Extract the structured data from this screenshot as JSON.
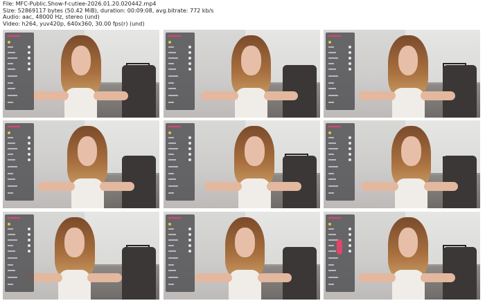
{
  "header": {
    "file": "File: MFC-Public.Show-f-cutiee-2026.01.20.020442.mp4",
    "size": "Size: 52869117 bytes (50.42 MiB), duration: 00:09:08, avg.bitrate: 772 kb/s",
    "audio": "Audio: aac, 48000 Hz, stereo (und)",
    "video": "Video: h264, yuv420p, 640x360, 30.00 fps(r) (und)"
  },
  "thumbnails": [
    {
      "id": "t1"
    },
    {
      "id": "t2"
    },
    {
      "id": "t3"
    },
    {
      "id": "t4"
    },
    {
      "id": "t5"
    },
    {
      "id": "t6"
    },
    {
      "id": "t7"
    },
    {
      "id": "t8"
    },
    {
      "id": "t9"
    }
  ],
  "colors": {
    "background": "#ffffff",
    "panel": "#46464a",
    "accent": "#e0466a"
  }
}
